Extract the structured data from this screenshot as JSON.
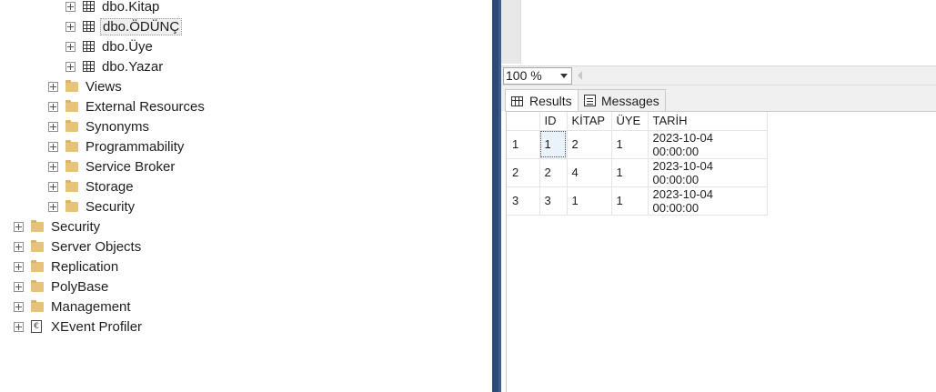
{
  "tree": {
    "tables": [
      "dbo.Kitap",
      "dbo.ÖDÜNÇ",
      "dbo.Üye",
      "dbo.Yazar"
    ],
    "selected_table": "dbo.ÖDÜNÇ",
    "db_folders": [
      "Views",
      "External Resources",
      "Synonyms",
      "Programmability",
      "Service Broker",
      "Storage",
      "Security"
    ],
    "server_folders": [
      "Security",
      "Server Objects",
      "Replication",
      "PolyBase",
      "Management"
    ],
    "xevent": "XEvent Profiler"
  },
  "zoom": {
    "value": "100 %"
  },
  "tabs": {
    "results": "Results",
    "messages": "Messages"
  },
  "grid": {
    "columns": [
      "ID",
      "KİTAP",
      "ÜYE",
      "TARİH"
    ],
    "rows": [
      {
        "n": "1",
        "cells": [
          "1",
          "2",
          "1",
          "2023-10-04 00:00:00"
        ]
      },
      {
        "n": "2",
        "cells": [
          "2",
          "4",
          "1",
          "2023-10-04 00:00:00"
        ]
      },
      {
        "n": "3",
        "cells": [
          "3",
          "1",
          "1",
          "2023-10-04 00:00:00"
        ]
      }
    ]
  },
  "colors": {
    "splitter": "#2d4a72",
    "folder": "#e6c27a",
    "selection": "#eaf2fb"
  },
  "icons": {
    "tree_expander": "plus-box-icon",
    "table": "table-icon",
    "folder": "folder-icon",
    "xevent": "xevent-profiler-icon",
    "results_tab": "grid-icon",
    "messages_tab": "messages-icon"
  }
}
